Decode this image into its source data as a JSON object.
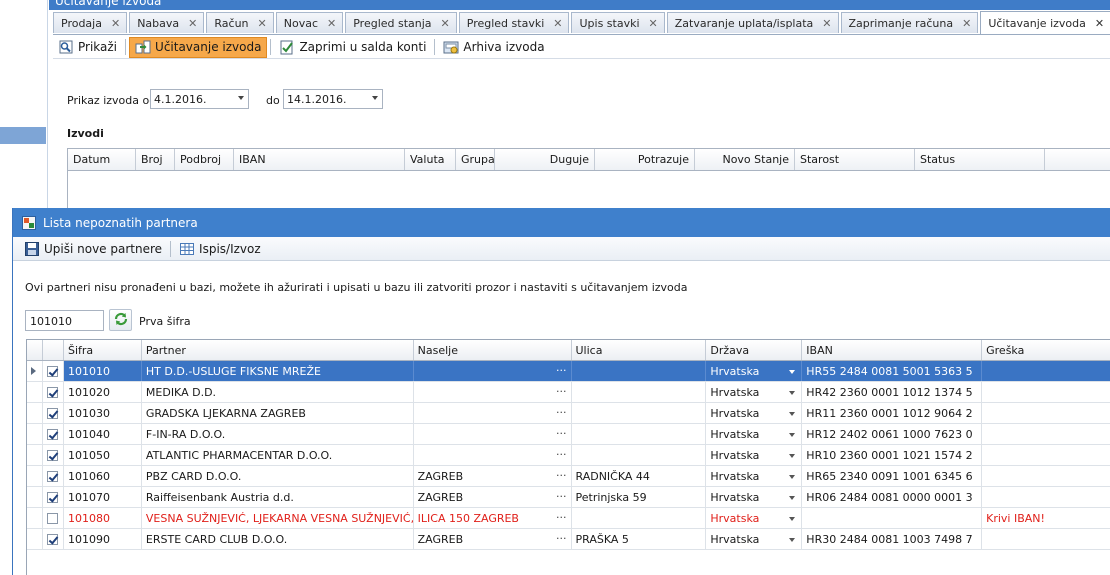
{
  "main": {
    "window_title": "Učitavanje izvoda",
    "tabs": [
      {
        "label": "Prodaja"
      },
      {
        "label": "Nabava"
      },
      {
        "label": "Račun"
      },
      {
        "label": "Novac"
      },
      {
        "label": "Pregled stanja"
      },
      {
        "label": "Pregled stavki"
      },
      {
        "label": "Upis stavki"
      },
      {
        "label": "Zatvaranje uplata/isplata"
      },
      {
        "label": "Zaprimanje računa"
      },
      {
        "label": "Učitavanje izvoda"
      }
    ],
    "toolbar": {
      "prikazi": "Prikaži",
      "ucitavanje": "Učitavanje izvoda",
      "zaprimi": "Zaprimi u salda konti",
      "arhiva": "Arhiva izvoda"
    },
    "filter": {
      "from_label": "Prikaz izvoda od",
      "from_value": "4.1.2016.",
      "to_label": "do",
      "to_value": "14.1.2016."
    },
    "section_title": "Izvodi",
    "columns": [
      "Datum",
      "Broj",
      "Podbroj",
      "IBAN",
      "Valuta",
      "Grupa",
      "Duguje",
      "Potrazuje",
      "Novo Stanje",
      "Starost",
      "Status"
    ]
  },
  "dialog": {
    "title": "Lista nepoznatih partnera",
    "toolbar": {
      "upisi": "Upiši nove partnere",
      "ispis": "Ispis/Izvoz"
    },
    "message": "Ovi partneri nisu pronađeni u bazi, možete ih ažurirati i upisati u bazu ili zatvoriti prozor i nastaviti s učitavanjem izvoda",
    "code_value": "101010",
    "prva_sifra": "Prva šifra",
    "columns": [
      "Šifra",
      "Partner",
      "Naselje",
      "Ulica",
      "Država",
      "IBAN",
      "Greška"
    ],
    "rows": [
      {
        "sifra": "101010",
        "partner": "HT D.D.-USLUGE FIKSNE MREŽE",
        "naselje": "",
        "ulica": "",
        "drzava": "Hrvatska",
        "iban": "HR55 2484 0081 5001 5363 5",
        "greska": "",
        "checked": true
      },
      {
        "sifra": "101020",
        "partner": "MEDIKA  D.D.",
        "naselje": "",
        "ulica": "",
        "drzava": "Hrvatska",
        "iban": "HR42 2360 0001 1012 1374 5",
        "greska": "",
        "checked": true
      },
      {
        "sifra": "101030",
        "partner": "GRADSKA LJEKARNA ZAGREB",
        "naselje": "",
        "ulica": "",
        "drzava": "Hrvatska",
        "iban": "HR11 2360 0001 1012 9064 2",
        "greska": "",
        "checked": true
      },
      {
        "sifra": "101040",
        "partner": "F-IN-RA D.O.O.",
        "naselje": "",
        "ulica": "",
        "drzava": "Hrvatska",
        "iban": "HR12 2402 0061 1000 7623 0",
        "greska": "",
        "checked": true
      },
      {
        "sifra": "101050",
        "partner": "ATLANTIC PHARMACENTAR D.O.O.",
        "naselje": "",
        "ulica": "",
        "drzava": "Hrvatska",
        "iban": "HR10 2360 0001 1021 1574 2",
        "greska": "",
        "checked": true
      },
      {
        "sifra": "101060",
        "partner": "PBZ CARD D.O.O.",
        "naselje": "ZAGREB",
        "ulica": "RADNIČKA 44",
        "drzava": "Hrvatska",
        "iban": "HR65 2340 0091 1001 6345 6",
        "greska": "",
        "checked": true
      },
      {
        "sifra": "101070",
        "partner": "Raiffeisenbank Austria d.d.",
        "naselje": "ZAGREB",
        "ulica": "Petrinjska 59",
        "drzava": "Hrvatska",
        "iban": "HR06 2484 0081 0000 0001 3",
        "greska": "",
        "checked": true
      },
      {
        "sifra": "101080",
        "partner": "VESNA SUŽNJEVIĆ, LJEKARNA VESNA SUŽNJEVIĆ, M...",
        "naselje": "ILICA 150 ZAGREB",
        "ulica": "",
        "drzava": "Hrvatska",
        "iban": "",
        "greska": "Krivi IBAN!",
        "checked": false
      },
      {
        "sifra": "101090",
        "partner": "ERSTE CARD CLUB D.O.O.",
        "naselje": "ZAGREB",
        "ulica": "PRAŠKA 5",
        "drzava": "Hrvatska",
        "iban": "HR30 2484 0081 1003 7498 7",
        "greska": "",
        "checked": true
      }
    ]
  }
}
